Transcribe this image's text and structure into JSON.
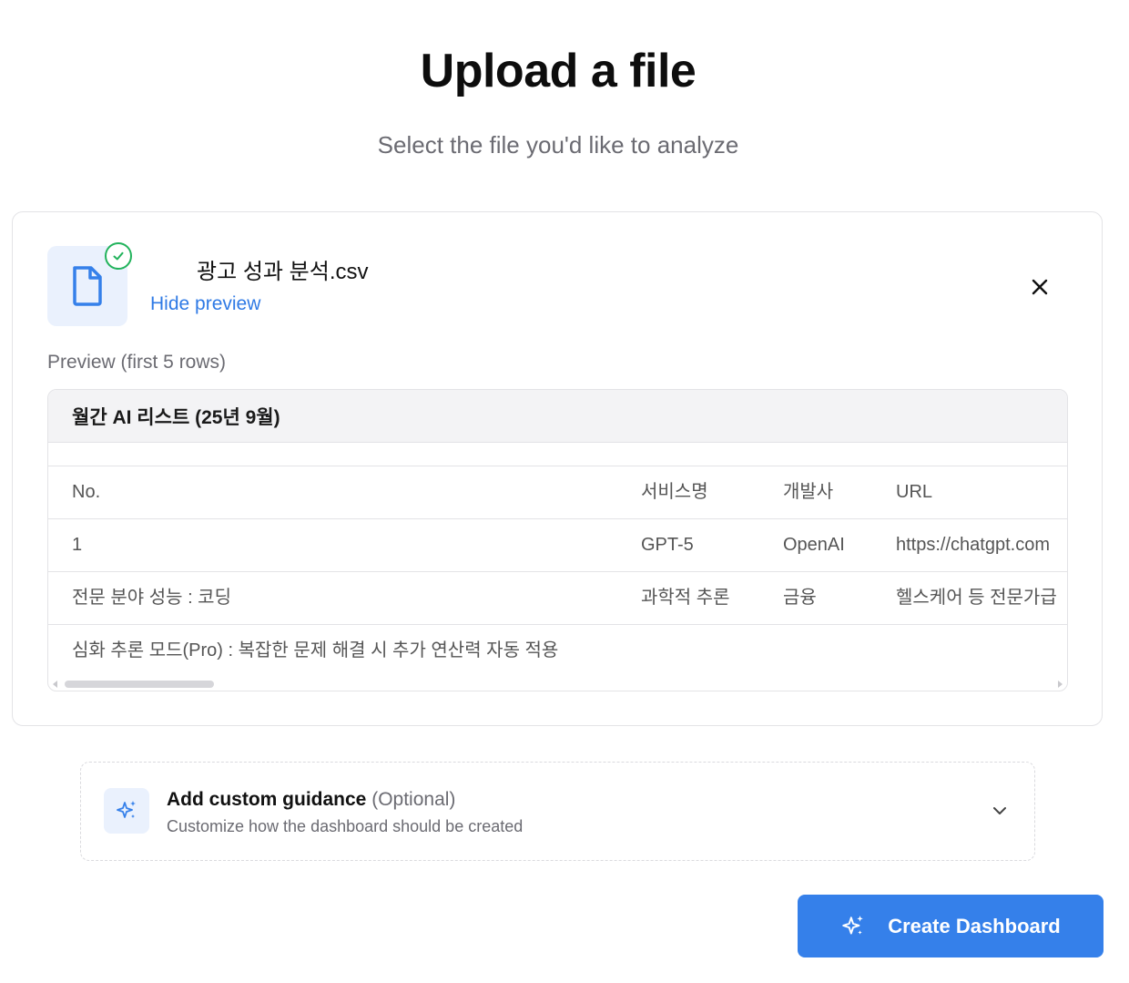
{
  "header": {
    "title": "Upload a file",
    "subtitle": "Select the file you'd like to analyze"
  },
  "file": {
    "name": "광고 성과 분석.csv",
    "hide_preview_label": "Hide preview",
    "status_icon": "check-circle-icon",
    "file_icon": "document-icon",
    "close_icon": "close-icon"
  },
  "preview": {
    "label": "Preview (first 5 rows)",
    "sheet_title": "월간 AI 리스트 (25년 9월)",
    "columns": [
      "No.",
      "서비스명",
      "개발사",
      "URL"
    ],
    "rows": [
      [
        "1",
        "GPT-5",
        "OpenAI",
        "https://chatgpt.com"
      ],
      [
        "전문 분야 성능 : 코딩",
        "과학적 추론",
        "금융",
        "헬스케어 등 전문가급"
      ],
      [
        "심화 추론 모드(Pro) : 복잡한 문제 해결 시 추가 연산력 자동 적용",
        "",
        "",
        ""
      ]
    ]
  },
  "guidance": {
    "title": "Add custom guidance",
    "optional": "(Optional)",
    "subtitle": "Customize how the dashboard should be created",
    "icon": "sparkle-icon",
    "expand_icon": "chevron-down-icon"
  },
  "actions": {
    "create_label": "Create Dashboard",
    "create_icon": "sparkle-icon"
  },
  "colors": {
    "accent": "#3580ea",
    "link": "#2f7ae5",
    "success": "#22b35c",
    "icon_bg": "#eaf1fd"
  }
}
